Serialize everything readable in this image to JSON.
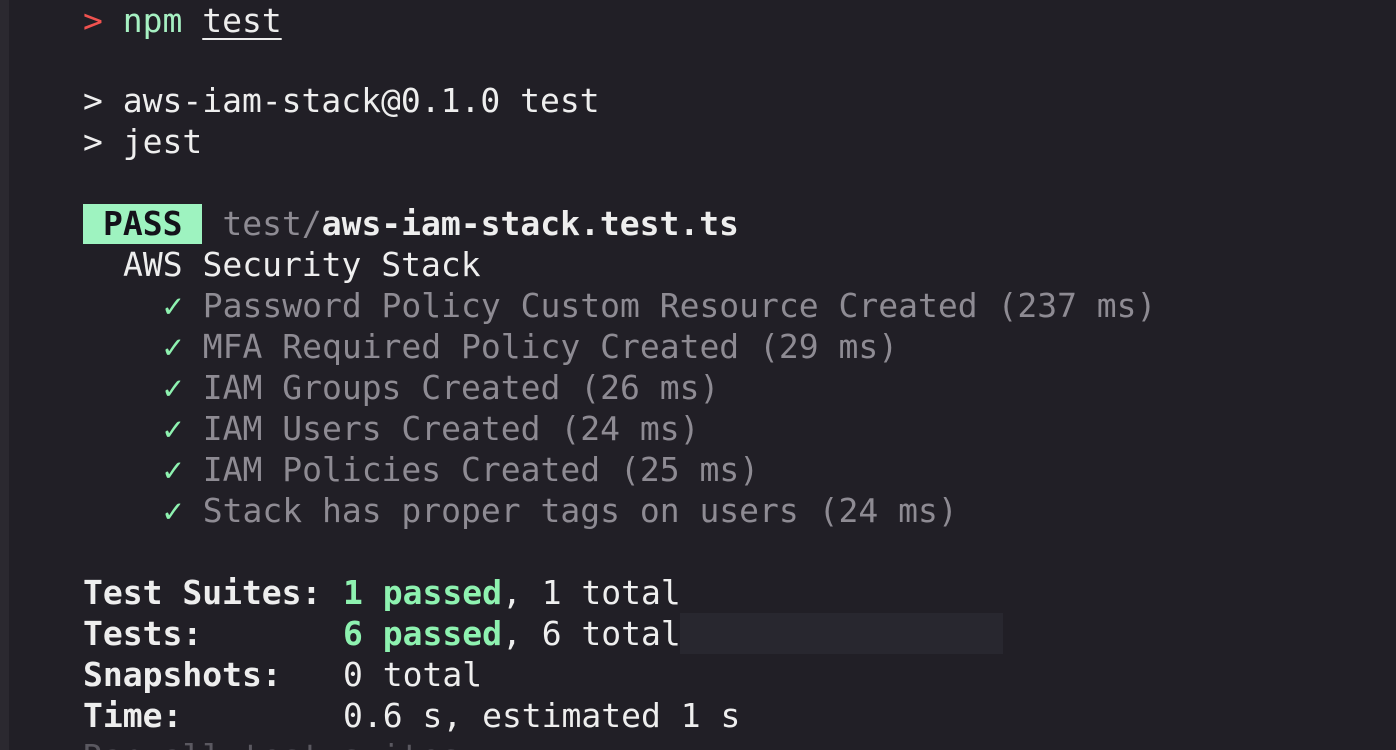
{
  "command": {
    "prompt_symbol": ">",
    "program": "npm",
    "argument": "test"
  },
  "script_lines": [
    "> aws-iam-stack@0.1.0 test",
    "> jest"
  ],
  "result": {
    "badge": "PASS",
    "file_dir": "test/",
    "file_name": "aws-iam-stack.test.ts",
    "suite_name": "AWS Security Stack",
    "check_glyph": "✓",
    "tests": [
      {
        "name": "Password Policy Custom Resource Created",
        "duration": "(237 ms)"
      },
      {
        "name": "MFA Required Policy Created",
        "duration": "(29 ms)"
      },
      {
        "name": "IAM Groups Created",
        "duration": "(26 ms)"
      },
      {
        "name": "IAM Users Created",
        "duration": "(24 ms)"
      },
      {
        "name": "IAM Policies Created",
        "duration": "(25 ms)"
      },
      {
        "name": "Stack has proper tags on users",
        "duration": "(24 ms)"
      }
    ]
  },
  "summary": {
    "suites": {
      "label": "Test Suites:",
      "passed": "1 passed",
      "total": ", 1 total"
    },
    "tests": {
      "label": "Tests:",
      "passed": "6 passed",
      "total": ", 6 total"
    },
    "snapshots": {
      "label": "Snapshots:",
      "value": "0 total"
    },
    "time": {
      "label": "Time:",
      "value": "0.6 s, estimated 1 s"
    },
    "footer": "Ran all test suites."
  },
  "colors": {
    "background": "#211f26",
    "prompt": "#f0524f",
    "success": "#8ef2b0",
    "pass_badge_bg": "#9ef3c0"
  }
}
